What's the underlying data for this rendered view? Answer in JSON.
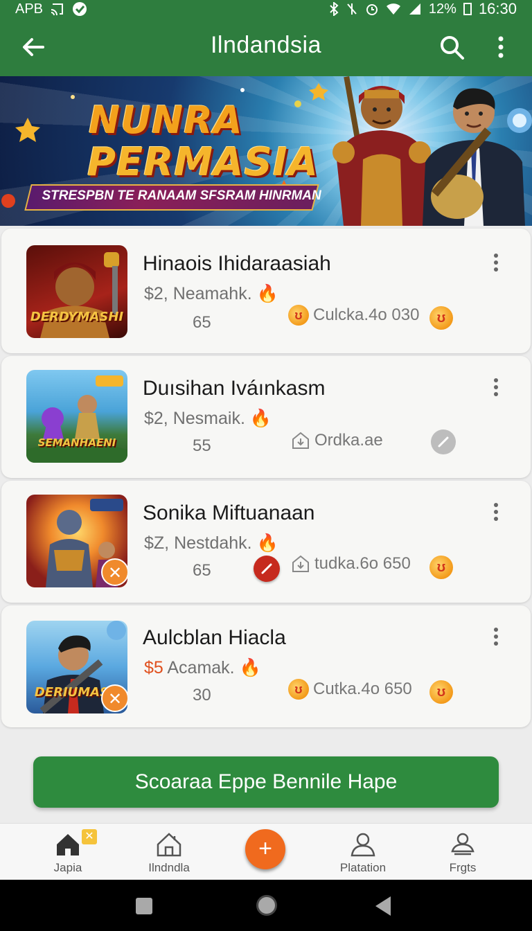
{
  "status_bar": {
    "carrier": "APB",
    "left_icons": [
      "cast-icon",
      "vpn-icon"
    ],
    "right_icons": [
      "bluetooth-icon",
      "mute-icon",
      "alarm-icon",
      "wifi-icon",
      "signal-icon"
    ],
    "battery": "12%",
    "time": "16:30"
  },
  "appbar": {
    "title": "Ilndandsia",
    "back_icon": "arrow-left-icon",
    "search_icon": "search-icon",
    "more_icon": "more-vertical-icon"
  },
  "banner": {
    "title_line1": "NUNRA",
    "title_line2": "PERMASIA",
    "tagline": "STRESPBN TE RANAAM SFSRAM HINRMAN"
  },
  "items": [
    {
      "name": "Hinaois Ihidaraasiah",
      "price_prefix": "",
      "price": "$2, Neamahk.",
      "count": "65",
      "thumb_text": "DERDYMASHI",
      "stat_text": "Culcka.4o  030",
      "stat_left_icon": "coin-icon",
      "stat_right_icon": "coin-icon"
    },
    {
      "name": "Duısihan Iváınkasm",
      "price_prefix": "",
      "price": "$2, Nesmaik.",
      "count": "55",
      "thumb_text": "SEMANHAENI",
      "stat_text": "Ordka.ae",
      "stat_left_icon": "download-box-icon",
      "stat_right_icon": "edit-disabled-icon"
    },
    {
      "name": "Sonika Miftuanaan",
      "price_prefix": "",
      "price": "$Z, Nestdahk.",
      "count": "65",
      "thumb_text": "",
      "stat_text": "tudka.6o  650",
      "stat_left_icon": "download-box-icon",
      "stat_right_icon": "coin-icon"
    },
    {
      "name": "Aulcblan Hiacla",
      "price_prefix": "$5",
      "price": " Acamak.",
      "count": "30",
      "thumb_text": "DERIUMASH",
      "stat_text": "Cutka.4o  650",
      "stat_left_icon": "coin-icon",
      "stat_right_icon": "coin-icon"
    }
  ],
  "cta": {
    "label": "Scoaraa Eppe Bennile Hape"
  },
  "bottom_nav": [
    {
      "label": "Japia",
      "icon": "home-icon",
      "badge": "✕"
    },
    {
      "label": "Ilndndla",
      "icon": "home-outline-icon"
    },
    {
      "label": "+",
      "icon": "add-icon"
    },
    {
      "label": "Platation",
      "icon": "person-icon"
    },
    {
      "label": "Frgts",
      "icon": "profile-icon"
    }
  ],
  "colors": {
    "primary_green": "#2e7d3e",
    "accent_orange": "#f06a1e",
    "coin": "#f39a1a"
  }
}
